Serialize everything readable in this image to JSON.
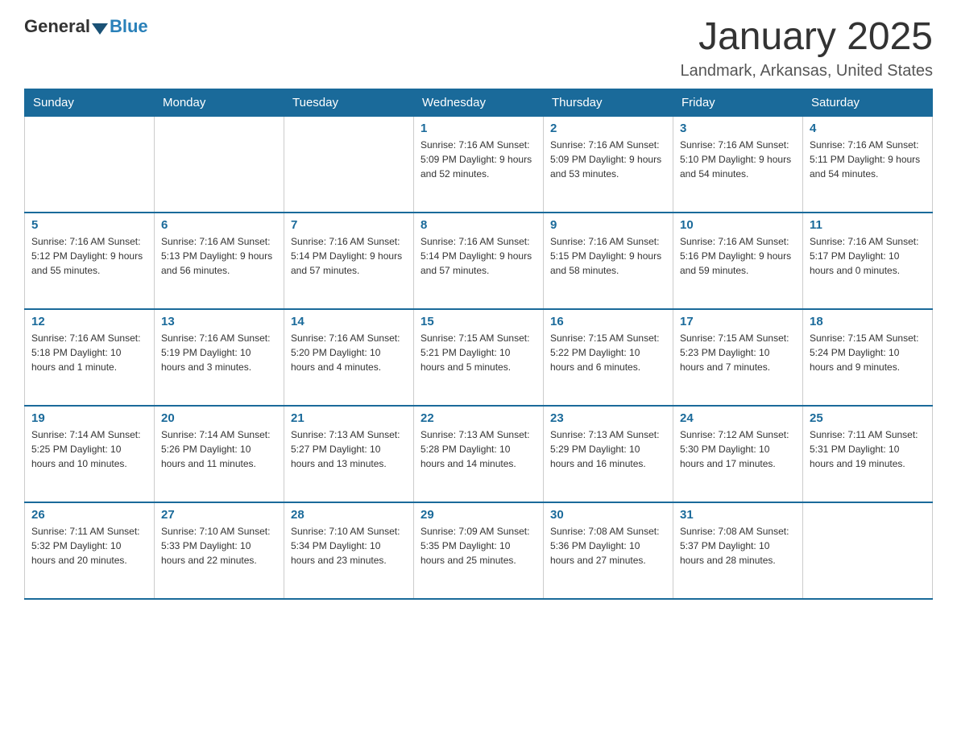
{
  "logo": {
    "part1": "General",
    "part2": "Blue"
  },
  "header": {
    "month": "January 2025",
    "location": "Landmark, Arkansas, United States"
  },
  "days_of_week": [
    "Sunday",
    "Monday",
    "Tuesday",
    "Wednesday",
    "Thursday",
    "Friday",
    "Saturday"
  ],
  "weeks": [
    [
      {
        "day": "",
        "info": ""
      },
      {
        "day": "",
        "info": ""
      },
      {
        "day": "",
        "info": ""
      },
      {
        "day": "1",
        "info": "Sunrise: 7:16 AM\nSunset: 5:09 PM\nDaylight: 9 hours and 52 minutes."
      },
      {
        "day": "2",
        "info": "Sunrise: 7:16 AM\nSunset: 5:09 PM\nDaylight: 9 hours and 53 minutes."
      },
      {
        "day": "3",
        "info": "Sunrise: 7:16 AM\nSunset: 5:10 PM\nDaylight: 9 hours and 54 minutes."
      },
      {
        "day": "4",
        "info": "Sunrise: 7:16 AM\nSunset: 5:11 PM\nDaylight: 9 hours and 54 minutes."
      }
    ],
    [
      {
        "day": "5",
        "info": "Sunrise: 7:16 AM\nSunset: 5:12 PM\nDaylight: 9 hours and 55 minutes."
      },
      {
        "day": "6",
        "info": "Sunrise: 7:16 AM\nSunset: 5:13 PM\nDaylight: 9 hours and 56 minutes."
      },
      {
        "day": "7",
        "info": "Sunrise: 7:16 AM\nSunset: 5:14 PM\nDaylight: 9 hours and 57 minutes."
      },
      {
        "day": "8",
        "info": "Sunrise: 7:16 AM\nSunset: 5:14 PM\nDaylight: 9 hours and 57 minutes."
      },
      {
        "day": "9",
        "info": "Sunrise: 7:16 AM\nSunset: 5:15 PM\nDaylight: 9 hours and 58 minutes."
      },
      {
        "day": "10",
        "info": "Sunrise: 7:16 AM\nSunset: 5:16 PM\nDaylight: 9 hours and 59 minutes."
      },
      {
        "day": "11",
        "info": "Sunrise: 7:16 AM\nSunset: 5:17 PM\nDaylight: 10 hours and 0 minutes."
      }
    ],
    [
      {
        "day": "12",
        "info": "Sunrise: 7:16 AM\nSunset: 5:18 PM\nDaylight: 10 hours and 1 minute."
      },
      {
        "day": "13",
        "info": "Sunrise: 7:16 AM\nSunset: 5:19 PM\nDaylight: 10 hours and 3 minutes."
      },
      {
        "day": "14",
        "info": "Sunrise: 7:16 AM\nSunset: 5:20 PM\nDaylight: 10 hours and 4 minutes."
      },
      {
        "day": "15",
        "info": "Sunrise: 7:15 AM\nSunset: 5:21 PM\nDaylight: 10 hours and 5 minutes."
      },
      {
        "day": "16",
        "info": "Sunrise: 7:15 AM\nSunset: 5:22 PM\nDaylight: 10 hours and 6 minutes."
      },
      {
        "day": "17",
        "info": "Sunrise: 7:15 AM\nSunset: 5:23 PM\nDaylight: 10 hours and 7 minutes."
      },
      {
        "day": "18",
        "info": "Sunrise: 7:15 AM\nSunset: 5:24 PM\nDaylight: 10 hours and 9 minutes."
      }
    ],
    [
      {
        "day": "19",
        "info": "Sunrise: 7:14 AM\nSunset: 5:25 PM\nDaylight: 10 hours and 10 minutes."
      },
      {
        "day": "20",
        "info": "Sunrise: 7:14 AM\nSunset: 5:26 PM\nDaylight: 10 hours and 11 minutes."
      },
      {
        "day": "21",
        "info": "Sunrise: 7:13 AM\nSunset: 5:27 PM\nDaylight: 10 hours and 13 minutes."
      },
      {
        "day": "22",
        "info": "Sunrise: 7:13 AM\nSunset: 5:28 PM\nDaylight: 10 hours and 14 minutes."
      },
      {
        "day": "23",
        "info": "Sunrise: 7:13 AM\nSunset: 5:29 PM\nDaylight: 10 hours and 16 minutes."
      },
      {
        "day": "24",
        "info": "Sunrise: 7:12 AM\nSunset: 5:30 PM\nDaylight: 10 hours and 17 minutes."
      },
      {
        "day": "25",
        "info": "Sunrise: 7:11 AM\nSunset: 5:31 PM\nDaylight: 10 hours and 19 minutes."
      }
    ],
    [
      {
        "day": "26",
        "info": "Sunrise: 7:11 AM\nSunset: 5:32 PM\nDaylight: 10 hours and 20 minutes."
      },
      {
        "day": "27",
        "info": "Sunrise: 7:10 AM\nSunset: 5:33 PM\nDaylight: 10 hours and 22 minutes."
      },
      {
        "day": "28",
        "info": "Sunrise: 7:10 AM\nSunset: 5:34 PM\nDaylight: 10 hours and 23 minutes."
      },
      {
        "day": "29",
        "info": "Sunrise: 7:09 AM\nSunset: 5:35 PM\nDaylight: 10 hours and 25 minutes."
      },
      {
        "day": "30",
        "info": "Sunrise: 7:08 AM\nSunset: 5:36 PM\nDaylight: 10 hours and 27 minutes."
      },
      {
        "day": "31",
        "info": "Sunrise: 7:08 AM\nSunset: 5:37 PM\nDaylight: 10 hours and 28 minutes."
      },
      {
        "day": "",
        "info": ""
      }
    ]
  ]
}
